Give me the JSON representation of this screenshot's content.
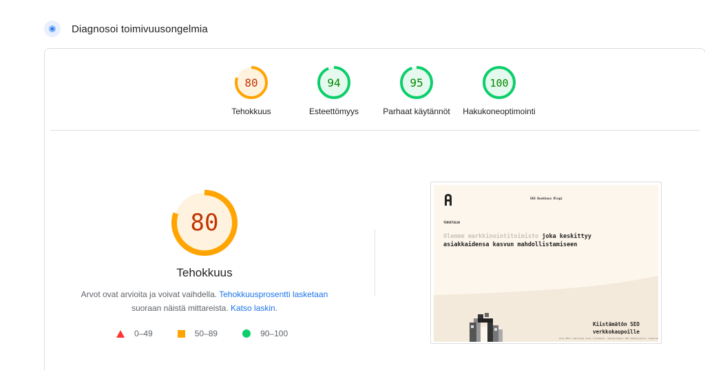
{
  "header": {
    "title": "Diagnosoi toimivuusongelmia",
    "icon": "diagnostics-icon"
  },
  "colors": {
    "average": "#ffa400",
    "average_text": "#c33300",
    "average_bg": "#fff3e0",
    "pass": "#0cce6b",
    "pass_text": "#008800",
    "pass_bg": "#e6f9ee",
    "fail": "#ff3333",
    "link": "#1a73e8"
  },
  "gauges": [
    {
      "score": 80,
      "label": "Tehokkuus",
      "rating": "average"
    },
    {
      "score": 94,
      "label": "Esteettömyys",
      "rating": "pass"
    },
    {
      "score": 95,
      "label": "Parhaat käytännöt",
      "rating": "pass"
    },
    {
      "score": 100,
      "label": "Hakukoneoptimointi",
      "rating": "pass"
    }
  ],
  "performance": {
    "score": 80,
    "title": "Tehokkuus",
    "desc_text": "Arvot ovat arvioita ja voivat vaihdella. ",
    "desc_link1": "Tehokkuusprosentti lasketaan",
    "desc_mid": " suoraan näistä mittareista. ",
    "desc_link2": "Katso laskin",
    "desc_end": "."
  },
  "legend": [
    {
      "range": "0–49",
      "shape": "triangle-icon"
    },
    {
      "range": "50–89",
      "shape": "square-icon"
    },
    {
      "range": "90–100",
      "shape": "circle-icon"
    }
  ],
  "screenshot": {
    "nav": "SEO  Bookkaus  Blogi",
    "welcome": "TERVETULOA",
    "headline_muted": "Olemme markkinointitoimisto",
    "headline_rest": " joka keskittyy",
    "headline_line2": "asiakkaidensa kasvun mahdollistamiseen",
    "promo_line1": "Kiistämätön SEO",
    "promo_line2": "verkkokaupoille",
    "fine_print": "Anna SEO:n vahvistaa sinun tilauksesi, kasvuprosessi SEO tekoälyvaltio, keskeiset SEOn"
  }
}
